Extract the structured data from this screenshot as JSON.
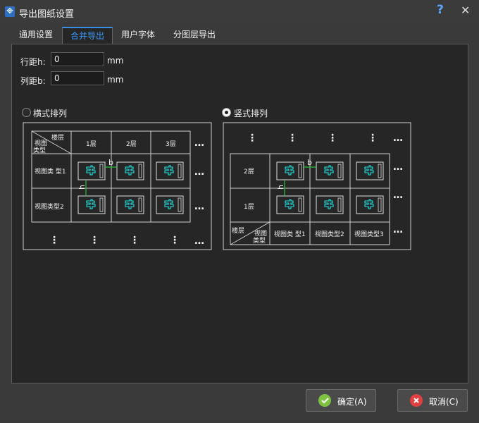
{
  "window": {
    "title": "导出图纸设置",
    "help_glyph": "?",
    "close_glyph": "✕"
  },
  "tabs": [
    {
      "label": "通用设置"
    },
    {
      "label": "合并导出"
    },
    {
      "label": "用户字体"
    },
    {
      "label": "分图层导出"
    }
  ],
  "active_tab": "合并导出",
  "fields": {
    "row_spacing": {
      "label": "行距h:",
      "value": "0",
      "unit": "mm"
    },
    "col_spacing": {
      "label": "列距b:",
      "value": "0",
      "unit": "mm"
    }
  },
  "layout_options": {
    "horizontal": {
      "label": "横式排列",
      "selected": false
    },
    "vertical": {
      "label": "竖式排列",
      "selected": true
    }
  },
  "horizontal_diagram": {
    "corner_top": "楼层",
    "corner_bottom": "视图\n类型",
    "columns": [
      "1层",
      "2层",
      "3层"
    ],
    "rows": [
      "视图类 型1",
      "视图类型2"
    ],
    "dim_b": "b",
    "dim_h": "h"
  },
  "vertical_diagram": {
    "rows": [
      "2层",
      "1层"
    ],
    "corner_top": "视图\n类型",
    "corner_bottom": "楼层",
    "columns": [
      "视图类 型1",
      "视图类型2",
      "视图类型3"
    ],
    "dim_b": "b",
    "dim_h": "h"
  },
  "buttons": {
    "ok": "确定(A)",
    "cancel": "取消(C)"
  },
  "colors": {
    "accent": "#3a9bff",
    "drawing_cyan": "#1ee6e6",
    "dimension_green": "#27c23a"
  }
}
